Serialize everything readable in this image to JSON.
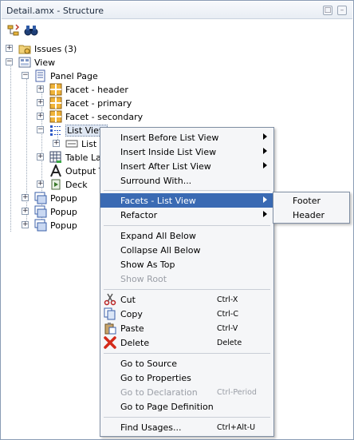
{
  "window": {
    "title": "Detail.amx - Structure",
    "controls": [
      "□",
      "–"
    ]
  },
  "toolbar": {
    "icons": [
      "tree-options-icon",
      "find-binoculars-icon"
    ]
  },
  "tree": {
    "issues": "Issues (3)",
    "view": "View",
    "panel_page": "Panel Page",
    "facet_header": "Facet - header",
    "facet_primary": "Facet - primary",
    "facet_secondary": "Facet - secondary",
    "list_view": "List View",
    "list_item": "List I",
    "table_layout": "Table La",
    "output_text": "Output T",
    "deck": "Deck",
    "popup1": "Popup",
    "popup2": "Popup",
    "popup3": "Popup"
  },
  "context_menu": {
    "insert_before": "Insert Before List View",
    "insert_inside": "Insert Inside List View",
    "insert_after": "Insert After List View",
    "surround_with": "Surround With...",
    "facets": "Facets - List View",
    "refactor": "Refactor",
    "expand_all": "Expand All Below",
    "collapse_all": "Collapse All Below",
    "show_as_top": "Show As Top",
    "show_root": "Show Root",
    "cut": "Cut",
    "cut_sc": "Ctrl-X",
    "copy": "Copy",
    "copy_sc": "Ctrl-C",
    "paste": "Paste",
    "paste_sc": "Ctrl-V",
    "delete": "Delete",
    "delete_sc": "Delete",
    "go_source": "Go to Source",
    "go_properties": "Go to Properties",
    "go_declaration": "Go to Declaration",
    "go_declaration_sc": "Ctrl-Period",
    "go_page_def": "Go to Page Definition",
    "find_usages": "Find Usages...",
    "find_usages_sc": "Ctrl+Alt-U"
  },
  "submenu": {
    "footer": "Footer",
    "header": "Header"
  },
  "colors": {
    "selection": "#3a6ab3",
    "menu_bg": "#f5f6f8",
    "disabled_text": "#9a9ea6"
  }
}
